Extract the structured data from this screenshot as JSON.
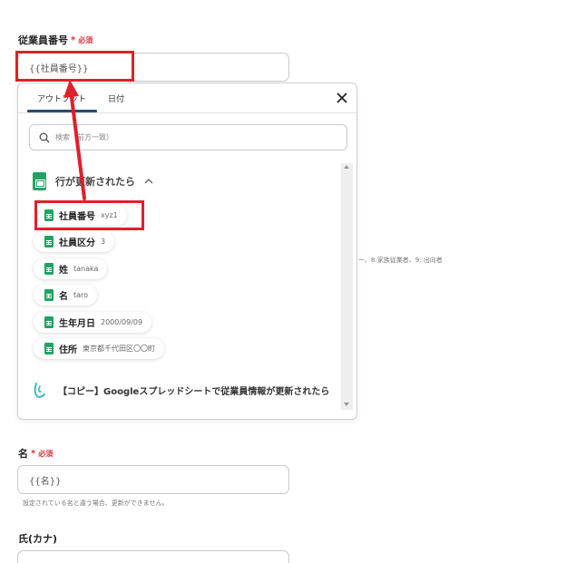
{
  "form": {
    "employee_no": {
      "label": "従業員番号",
      "required_star": "*",
      "required_text": "必須",
      "value": "{{社員番号}}"
    },
    "given_name": {
      "label": "名",
      "required_star": "*",
      "required_text": "必須",
      "value": "{{名}}",
      "help": "設定されている名と違う場合、更新ができません。"
    },
    "kana_surname": {
      "label": "氏(カナ)"
    },
    "bg_help_fragment": "ー、8:家族従業者、9: 出向者"
  },
  "dropdown": {
    "tabs": [
      {
        "label": "アウトプット",
        "active": true
      },
      {
        "label": "日付",
        "active": false
      }
    ],
    "close_icon": "close-icon",
    "search_placeholder": "検索（前方一致）",
    "group": {
      "title": "行が更新されたら",
      "icon": "google-sheets-icon",
      "expanded": true
    },
    "items": [
      {
        "name": "社員番号",
        "value": "xyz1"
      },
      {
        "name": "社員区分",
        "value": "3"
      },
      {
        "name": "姓",
        "value": "tanaka"
      },
      {
        "name": "名",
        "value": "taro"
      },
      {
        "name": "生年月日",
        "value": "2000/09/09"
      },
      {
        "name": "住所",
        "value": "東京都千代田区〇〇町"
      }
    ],
    "flow_item": {
      "icon": "yoom-flow-icon",
      "label": "【コピー】Googleスプレッドシートで従業員情報が更新されたら"
    }
  },
  "annotation": {
    "color": "#e0202a"
  }
}
